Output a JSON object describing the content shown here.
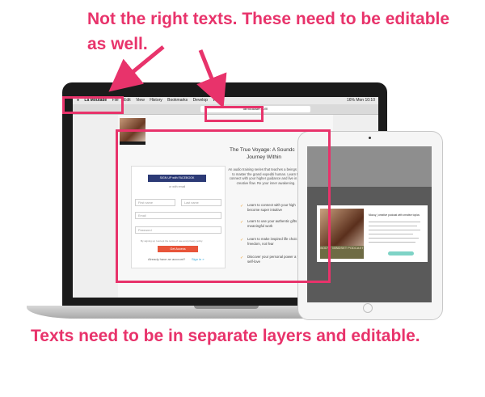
{
  "annotations": {
    "top": "Not the right texts. These need to be editable as well.",
    "bottom": "Texts need to be in separate layers and editable."
  },
  "menubar": {
    "app_name": "La Moutade",
    "items": [
      "File",
      "Edit",
      "View",
      "History",
      "Bookmarks",
      "Develop",
      "Wi..."
    ],
    "status": "16%  Mon 10:10"
  },
  "browser": {
    "url": "lamoutade.com"
  },
  "page": {
    "title_line1": "The True Voyage: A Soundc",
    "title_line2": "Journey Within",
    "description": "An audio training series that teaches a beings how to master the grand expediti human. Learn to connect with your higher guidance and live in the creative flow. Re your inner awakening.",
    "facebook_button": "SIGN UP with FACEBOOK",
    "or_email": "or with email",
    "first_name_placeholder": "First name",
    "last_name_placeholder": "Last name",
    "email_placeholder": "Email",
    "password_placeholder": "Password",
    "terms": "By signing up I accept the terms of use and privacy policy.",
    "get_access_button": "Get Access",
    "have_account": "Already have an account?",
    "sign_in_link": "Sign in »",
    "bullets": [
      "Learn to connect with your high become super intuitive",
      "Learn to use your authentic gifts meaningful work",
      "Learn to make inspired life choic freedom, not fear",
      "Discover your personal power a your self-love"
    ]
  },
  "ipad": {
    "modal_caption": "BODY · MINDSET PODCAST",
    "modal_title": "Mousy | creative podcast with creative topics"
  },
  "colors": {
    "accent": "#e8336b",
    "facebook": "#2c3a76",
    "cta": "#e8553a"
  }
}
